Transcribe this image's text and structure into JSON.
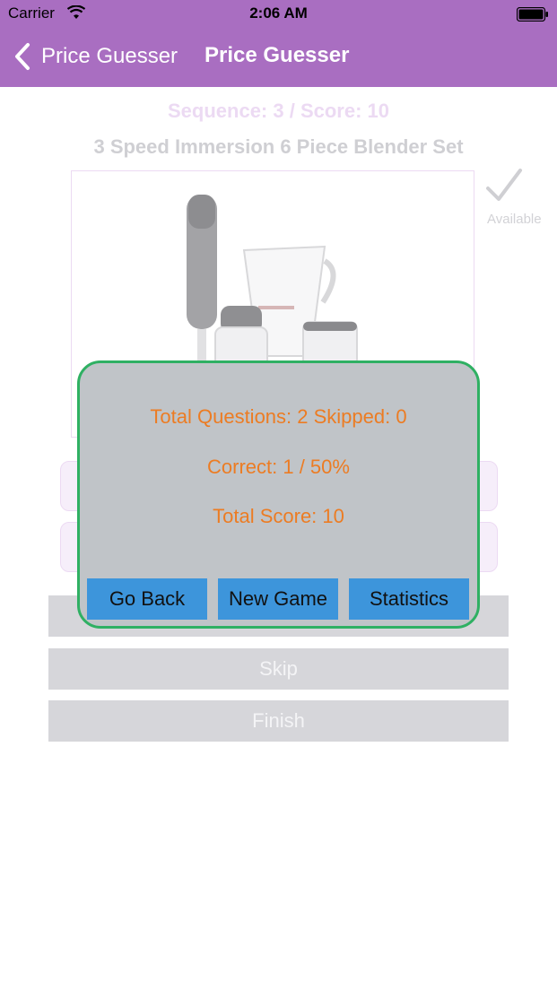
{
  "status_bar": {
    "carrier": "Carrier",
    "time": "2:06 AM",
    "icons": [
      "wifi-icon",
      "battery-icon"
    ]
  },
  "nav": {
    "back_label": "Price Guesser",
    "title": "Price Guesser",
    "color": "#a96ec1"
  },
  "game": {
    "sequence_score": "Sequence: 3 / Score: 10",
    "product_title": "3 Speed Immersion 6 Piece Blender Set",
    "availability": "Available"
  },
  "actions": {
    "skip_label": "Skip",
    "finish_label": "Finish"
  },
  "results_popup": {
    "questions_line": "Total Questions: 2 Skipped: 0",
    "correct_line": "Correct: 1 / 50%",
    "score_line": "Total Score: 10",
    "go_back_label": "Go Back",
    "new_game_label": "New Game",
    "statistics_label": "Statistics",
    "border_color": "#2fb063",
    "text_color": "#ec7c23",
    "button_color": "#3d95db"
  }
}
